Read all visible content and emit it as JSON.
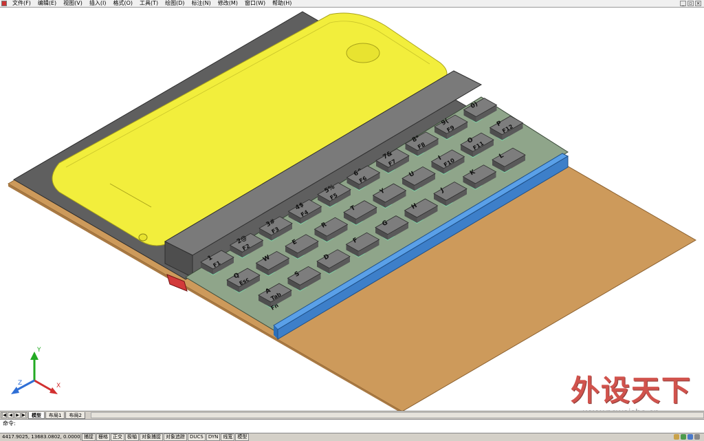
{
  "menu": {
    "items": [
      "文件(F)",
      "编辑(E)",
      "视图(V)",
      "插入(I)",
      "格式(O)",
      "工具(T)",
      "绘图(D)",
      "标注(N)",
      "修改(M)",
      "窗口(W)",
      "帮助(H)"
    ]
  },
  "layout_tabs": {
    "tabs": [
      "模型",
      "布局1",
      "布局2"
    ],
    "active": "模型"
  },
  "command": {
    "prompt": "命令:"
  },
  "status": {
    "coords": "4417.9025, 13683.0802, 0.0000",
    "toggles": [
      "捕捉",
      "栅格",
      "正交",
      "极轴",
      "对象捕捉",
      "对象追踪",
      "DUCS",
      "DYN",
      "线宽",
      "模型"
    ]
  },
  "ucs": {
    "x_label": "X",
    "y_label": "Y",
    "z_label": "Z"
  },
  "keyboard": {
    "row1": [
      {
        "top": "1",
        "bottom": "F1"
      },
      {
        "top": "2@",
        "bottom": "F2"
      },
      {
        "top": "3#",
        "bottom": "F3"
      },
      {
        "top": "4$",
        "bottom": "F4"
      },
      {
        "top": "5%",
        "bottom": "F5"
      },
      {
        "top": "6^",
        "bottom": "F6"
      },
      {
        "top": "7&",
        "bottom": "F7"
      },
      {
        "top": "8*",
        "bottom": "F8"
      },
      {
        "top": "9(",
        "bottom": "F9"
      },
      {
        "top": "0)",
        "bottom": ""
      }
    ],
    "row2": [
      {
        "top": "Q",
        "bottom": "Esc"
      },
      {
        "top": "W",
        "bottom": ""
      },
      {
        "top": "E",
        "bottom": ""
      },
      {
        "top": "R",
        "bottom": ""
      },
      {
        "top": "T",
        "bottom": ""
      },
      {
        "top": "Y",
        "bottom": ""
      },
      {
        "top": "U",
        "bottom": ""
      },
      {
        "top": "I",
        "bottom": "F10"
      },
      {
        "top": "O",
        "bottom": "F11"
      },
      {
        "top": "P",
        "bottom": "F12"
      }
    ],
    "row3": [
      {
        "top": "A",
        "bottom": "Tab"
      },
      {
        "top": "S",
        "bottom": ""
      },
      {
        "top": "D",
        "bottom": ""
      },
      {
        "top": "F",
        "bottom": ""
      },
      {
        "top": "G",
        "bottom": ""
      },
      {
        "top": "H",
        "bottom": ""
      },
      {
        "top": "J",
        "bottom": ""
      },
      {
        "top": "K",
        "bottom": ""
      },
      {
        "top": "L",
        "bottom": ""
      }
    ],
    "row3_extra_label": "Fn"
  },
  "watermark": {
    "logo_text": "外设天下",
    "url": "www.pcwaishe.cn"
  },
  "colors": {
    "phone": "#f2ee3c",
    "base_board": "#cd9a5b",
    "blue_rail": "#3d7fc9",
    "keycap": "#7d7d7d",
    "slot_green": "#7ee0b0",
    "dark_bar": "#6e6e6e"
  }
}
